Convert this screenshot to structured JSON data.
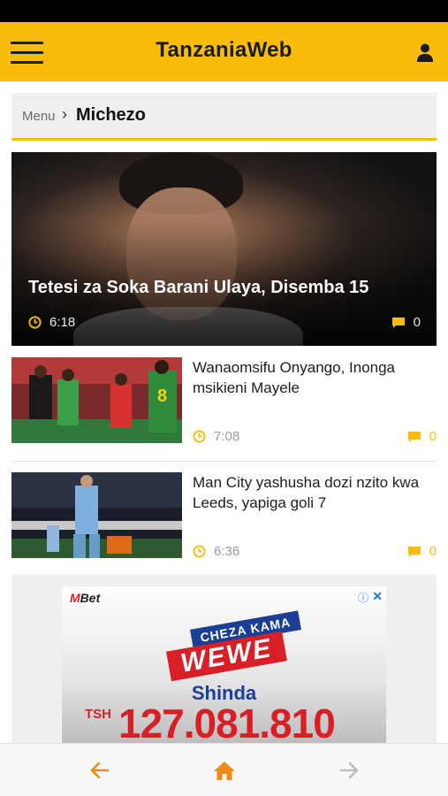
{
  "app": {
    "title": "TanzaniaWeb"
  },
  "breadcrumb": {
    "root": "Menu",
    "separator": "›",
    "current": "Michezo"
  },
  "featured": {
    "title": "Tetesi za Soka Barani Ulaya, Disemba 15",
    "time": "6:18",
    "comments": "0"
  },
  "articles": [
    {
      "title": "Wanaomsifu Onyango, Inonga msikieni Mayele",
      "time": "7:08",
      "comments": "0"
    },
    {
      "title": "Man City yashusha dozi nzito kwa Leeds, yapiga goli 7",
      "time": "6:36",
      "comments": "0"
    }
  ],
  "ad": {
    "logo_prefix": "M",
    "logo_suffix": "Bet",
    "tagline_top": "CHEZA KAMA",
    "tagline_main": "WEWE",
    "headline": "Shinda",
    "currency": "TSH",
    "amount": "127.081.810"
  },
  "bottom_nav": {
    "back": "back-arrow-icon",
    "home": "home-icon",
    "forward": "forward-arrow-icon"
  },
  "colors": {
    "accent": "#f9bb0c",
    "text_dark": "#1d1d1d",
    "muted": "#9a9a9a",
    "ad_red": "#d81f26",
    "ad_blue": "#1d3f93"
  }
}
